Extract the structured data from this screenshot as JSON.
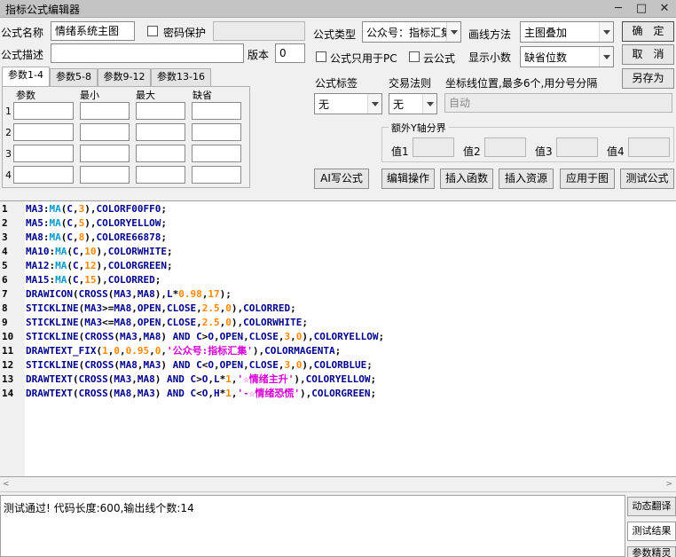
{
  "window": {
    "title": "指标公式编辑器",
    "minimize_glyph": "─",
    "maximize_glyph": "□",
    "close_glyph": "✕"
  },
  "form": {
    "formula_name_label": "公式名称",
    "formula_name_value": "情绪系统主图",
    "password_label": "密码保护",
    "password_value": "",
    "formula_desc_label": "公式描述",
    "formula_desc_value": "",
    "version_label": "版本",
    "version_value": "0",
    "formula_type_label": "公式类型",
    "formula_type_value": "公众号：指标汇集",
    "draw_method_label": "画线方法",
    "draw_method_value": "主图叠加",
    "pc_only_label": "公式只用于PC",
    "cloud_label": "云公式",
    "decimals_label": "显示小数",
    "decimals_value": "缺省位数",
    "formula_tag_label": "公式标签",
    "formula_tag_value": "无",
    "trade_rule_label": "交易法则",
    "trade_rule_value": "无",
    "coord_label": "坐标线位置,最多6个,用分号分隔",
    "coord_placeholder": "自动",
    "extra_y_label": "额外Y轴分界",
    "y_values": [
      "值1",
      "值2",
      "值3",
      "值4"
    ]
  },
  "tabs": [
    "参数1-4",
    "参数5-8",
    "参数9-12",
    "参数13-16"
  ],
  "params": {
    "headers": [
      "参数",
      "最小",
      "最大",
      "缺省"
    ],
    "rows": [
      "1",
      "2",
      "3",
      "4"
    ]
  },
  "buttons": {
    "ok": "确　定",
    "cancel": "取　消",
    "save_as": "另存为",
    "ai_write": "AI写公式",
    "edit_ops": "编辑操作",
    "insert_func": "插入函数",
    "insert_res": "插入资源",
    "apply_chart": "应用于图",
    "test_formula": "测试公式"
  },
  "code": [
    "MA3:MA(C,3),COLORF00FF0;",
    "MA5:MA(C,5),COLORYELLOW;",
    "MA8:MA(C,8),COLORE66878;",
    "MA10:MA(C,10),COLORWHITE;",
    "MA12:MA(C,12),COLORGREEN;",
    "MA15:MA(C,15),COLORRED;",
    "DRAWICON(CROSS(MA3,MA8),L*0.98,17);",
    "STICKLINE(MA3>=MA8,OPEN,CLOSE,2.5,0),COLORRED;",
    "STICKLINE(MA3<=MA8,OPEN,CLOSE,2.5,0),COLORWHITE;",
    "STICKLINE(CROSS(MA3,MA8) AND C>O,OPEN,CLOSE,3,0),COLORYELLOW;",
    "DRAWTEXT_FIX(1,0,0.95,0,'公众号:指标汇集'),COLORMAGENTA;",
    "STICKLINE(CROSS(MA8,MA3) AND C<O,OPEN,CLOSE,3,0),COLORBLUE;",
    "DRAWTEXT(CROSS(MA3,MA8) AND C>O,L*1,'☆情绪主升'),COLORYELLOW;",
    "DRAWTEXT(CROSS(MA8,MA3) AND C<O,H*1,'-☆情绪恐慌'),COLORGREEN;"
  ],
  "output": {
    "message": "测试通过! 代码长度:600,输出线个数:14"
  },
  "side_tabs": [
    "动态翻译",
    "测试结果",
    "参数精灵"
  ],
  "colors": {
    "keyword": "#00008b",
    "function": "#0099cc",
    "number": "#ff8800",
    "string": "#d600d6"
  }
}
